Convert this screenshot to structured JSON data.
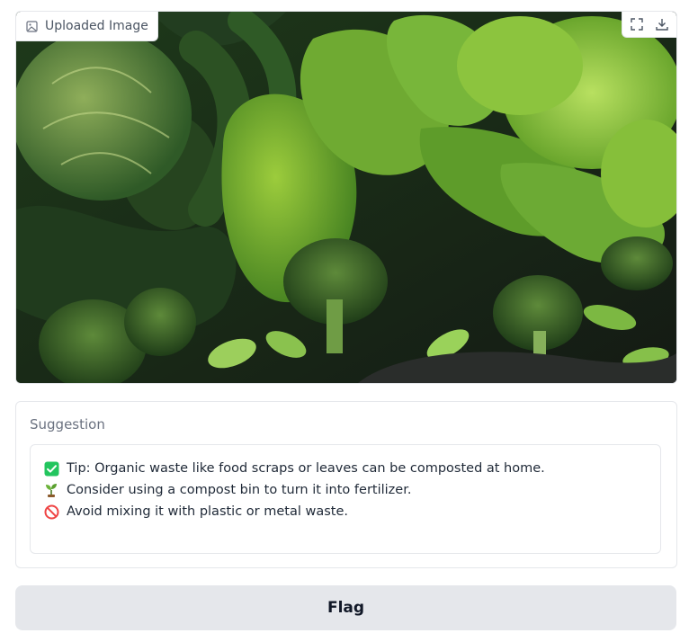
{
  "image_panel": {
    "label": "Uploaded Image",
    "label_icon": "image-icon",
    "actions": [
      "fullscreen-icon",
      "download-icon"
    ],
    "image_subject": "leafy green vegetables"
  },
  "suggestion": {
    "title": "Suggestion",
    "lines": [
      {
        "icon": "check-mark-icon",
        "text": "Tip: Organic waste like food scraps or leaves can be composted at home."
      },
      {
        "icon": "seedling-icon",
        "text": "Consider using a compost bin to turn it into fertilizer."
      },
      {
        "icon": "prohibited-icon",
        "text": "Avoid mixing it with plastic or metal waste."
      }
    ]
  },
  "flag_button": {
    "label": "Flag"
  },
  "colors": {
    "border": "#e5e7eb",
    "button_bg": "#e5e7eb",
    "check_green": "#22c55e",
    "prohibited_red": "#ef4444"
  }
}
